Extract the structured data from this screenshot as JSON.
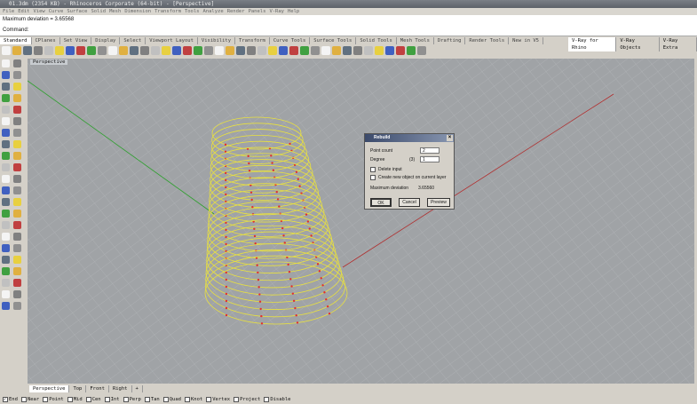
{
  "window": {
    "title": "01.3dm (2354 KB) - Rhinoceros Corporate (64-bit) - [Perspective]"
  },
  "menu": [
    "File",
    "Edit",
    "View",
    "Curve",
    "Surface",
    "Solid",
    "Mesh",
    "Dimension",
    "Transform",
    "Tools",
    "Analyze",
    "Render",
    "Panels",
    "V-Ray",
    "Help"
  ],
  "command": {
    "history": "Maximum deviation = 3.65568",
    "prompt": "Command:"
  },
  "toolbar_tabs": [
    "Standard",
    "CPlanes",
    "Set View",
    "Display",
    "Select",
    "Viewport Layout",
    "Visibility",
    "Transform",
    "Curve Tools",
    "Surface Tools",
    "Solid Tools",
    "Mesh Tools",
    "Drafting",
    "Render Tools",
    "New in V5"
  ],
  "vray_tabs": [
    "V-Ray for Rhino",
    "V-Ray Objects",
    "V-Ray Extra"
  ],
  "viewport": {
    "label": "Perspective"
  },
  "viewport_tabs": [
    "Perspective",
    "Top",
    "Front",
    "Right",
    "+"
  ],
  "osnaps": [
    {
      "label": "End",
      "checked": true
    },
    {
      "label": "Near",
      "checked": false
    },
    {
      "label": "Point",
      "checked": false
    },
    {
      "label": "Mid",
      "checked": false
    },
    {
      "label": "Cen",
      "checked": false
    },
    {
      "label": "Int",
      "checked": false
    },
    {
      "label": "Perp",
      "checked": false
    },
    {
      "label": "Tan",
      "checked": false
    },
    {
      "label": "Quad",
      "checked": false
    },
    {
      "label": "Knot",
      "checked": false
    },
    {
      "label": "Vertex",
      "checked": false
    },
    {
      "label": "Project",
      "checked": false
    },
    {
      "label": "Disable",
      "checked": false
    }
  ],
  "dialog": {
    "title": "Rebuild",
    "point_count_label": "Point count",
    "point_count": "2",
    "degree_label": "Degree",
    "degree_current": "(3)",
    "degree": "1",
    "delete_input": "Delete input",
    "create_new": "Create new object on current layer",
    "max_dev_label": "Maximum deviation",
    "max_dev": "3.65560",
    "ok": "OK",
    "cancel": "Cancel",
    "preview": "Preview"
  },
  "colors": {
    "curves": "#e8e040",
    "points": "#e03030",
    "x_axis": "#b03030",
    "y_axis": "#30a030",
    "viewport_bg": "#a0a3a6"
  }
}
